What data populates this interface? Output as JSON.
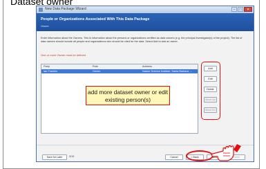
{
  "slide_title": "Dataset owner",
  "window": {
    "title": "New Data Package Wizard",
    "buttons": [
      "–",
      "□",
      "✕"
    ]
  },
  "header": {
    "title": "People or Organizations Associated With This Data Package",
    "subtitle": "Owner"
  },
  "description": "Enter information about the Owners. This is information about the persons or organizations certified as data owners (e.g. the principal investigator(s) of the project). The list of data owners should include all people and organizations who should be cited for the data. Select Add to add an owner.",
  "warning": "One or more Owner must be defined",
  "table": {
    "columns": [
      "Party",
      "Role",
      "Address"
    ],
    "rows": [
      [
        "Ian Franklin",
        "Owner",
        "Nature Science Institute, Santa Barbara, ..."
      ]
    ]
  },
  "side_buttons": [
    {
      "label": "Add",
      "enabled": true
    },
    {
      "label": "Edit",
      "enabled": true
    },
    {
      "label": "Delete",
      "enabled": true
    },
    {
      "label": "Move Up",
      "enabled": false
    },
    {
      "label": "Move Dn",
      "enabled": false
    }
  ],
  "callout": "add more dataset owner or edit existing person(s)",
  "footer": {
    "save_later": "Save for Later",
    "progress": "3/15",
    "cancel": "Cancel",
    "back": "< Back",
    "next": "Next >",
    "finish": "Finish"
  }
}
